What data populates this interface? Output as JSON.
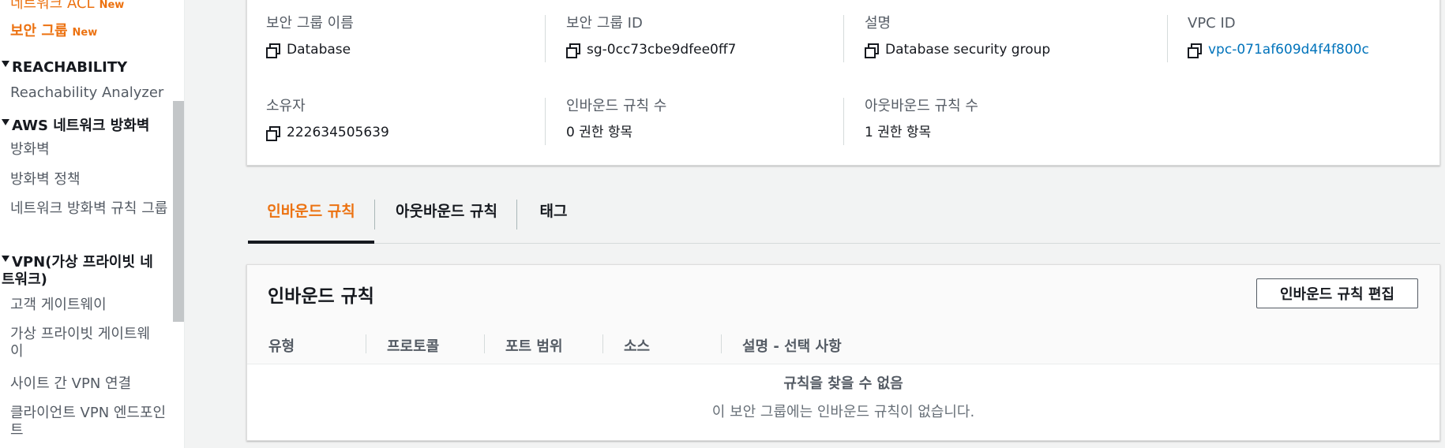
{
  "sidebar": {
    "items": [
      {
        "label": "네트워크 ACL",
        "badge": "New"
      },
      {
        "label": "보안 그룹",
        "badge": "New"
      }
    ],
    "sections": [
      {
        "title": "REACHABILITY",
        "items": [
          "Reachability Analyzer"
        ]
      },
      {
        "title": "AWS 네트워크 방화벽",
        "items": [
          "방화벽",
          "방화벽 정책",
          "네트워크 방화벽 규칙 그룹"
        ]
      },
      {
        "title": "VPN(가상 프라이빗 네트워크)",
        "items": [
          "고객 게이트웨이",
          "가상 프라이빗 게이트웨이",
          "사이트 간 VPN 연결",
          "클라이언트 VPN 엔드포인트"
        ]
      }
    ]
  },
  "details": {
    "fields": [
      {
        "label": "보안 그룹 이름",
        "value": "Database"
      },
      {
        "label": "보안 그룹 ID",
        "value": "sg-0cc73cbe9dfee0ff7"
      },
      {
        "label": "설명",
        "value": "Database security group"
      },
      {
        "label": "VPC ID",
        "value": "vpc-071af609d4f4f800c"
      },
      {
        "label": "소유자",
        "value": "222634505639"
      },
      {
        "label": "인바운드 규칙 수",
        "value": "0 권한 항목"
      },
      {
        "label": "아웃바운드 규칙 수",
        "value": "1 권한 항목"
      }
    ]
  },
  "tabs": [
    {
      "label": "인바운드 규칙",
      "active": true
    },
    {
      "label": "아웃바운드 규칙",
      "active": false
    },
    {
      "label": "태그",
      "active": false
    }
  ],
  "rules": {
    "title": "인바운드 규칙",
    "edit_button": "인바운드 규칙 편집",
    "columns": [
      "유형",
      "프로토콜",
      "포트 범위",
      "소스",
      "설명 - 선택 사항"
    ],
    "empty_title": "규칙을 찾을 수 없음",
    "empty_description": "이 보안 그룹에는 인바운드 규칙이 없습니다."
  },
  "colors": {
    "accent": "#ec7211",
    "link": "#0073bb",
    "text": "#16191f",
    "muted": "#545b64"
  }
}
